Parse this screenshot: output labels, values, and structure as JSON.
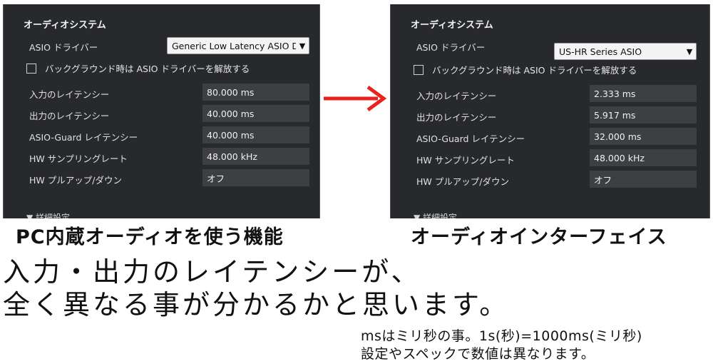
{
  "panels": {
    "left": {
      "title": "オーディオシステム",
      "driver_label": "ASIO ドライバー",
      "driver_value": "Generic Low Latency ASIO Dri.",
      "background_option": "バックグラウンド時は ASIO ドライバーを解放する",
      "rows": [
        {
          "label": "入力のレイテンシー",
          "value": "80.000 ms"
        },
        {
          "label": "出力のレイテンシー",
          "value": "40.000 ms"
        },
        {
          "label": "ASIO-Guard レイテンシー",
          "value": "40.000 ms"
        },
        {
          "label": "HW サンプリングレート",
          "value": "48.000 kHz"
        },
        {
          "label": "HW プルアップ/ダウン",
          "value": "オフ"
        }
      ],
      "detail": "▼ 詳細設定"
    },
    "right": {
      "title": "オーディオシステム",
      "driver_label": "ASIO ドライバー",
      "driver_value": "US-HR Series ASIO",
      "background_option": "バックグラウンド時は ASIO ドライバーを解放する",
      "rows": [
        {
          "label": "入力のレイテンシー",
          "value": "2.333 ms"
        },
        {
          "label": "出力のレイテンシー",
          "value": "5.917 ms"
        },
        {
          "label": "ASIO-Guard レイテンシー",
          "value": "32.000 ms"
        },
        {
          "label": "HW サンプリングレート",
          "value": "48.000 kHz"
        },
        {
          "label": "HW プルアップ/ダウン",
          "value": "オフ"
        }
      ],
      "detail": "▼ 詳細設定"
    }
  },
  "captions": {
    "left": "PC内蔵オーディオを使う機能",
    "right": "オーディオインターフェイス"
  },
  "main_text": {
    "line1": "入力・出力のレイテンシーが、",
    "line2": "全く異なる事が分かるかと思います。"
  },
  "notes": {
    "line1": "msはミリ秒の事。1s(秒)=1000ms(ミリ秒)",
    "line2": "設定やスペックで数値は異なります。"
  },
  "colors": {
    "panel_bg": "#28292d",
    "field_bg": "#3d3f43",
    "arrow": "#e8231e"
  },
  "icons": {
    "dropdown": "chevron-down-icon",
    "arrow": "right-arrow-icon"
  }
}
